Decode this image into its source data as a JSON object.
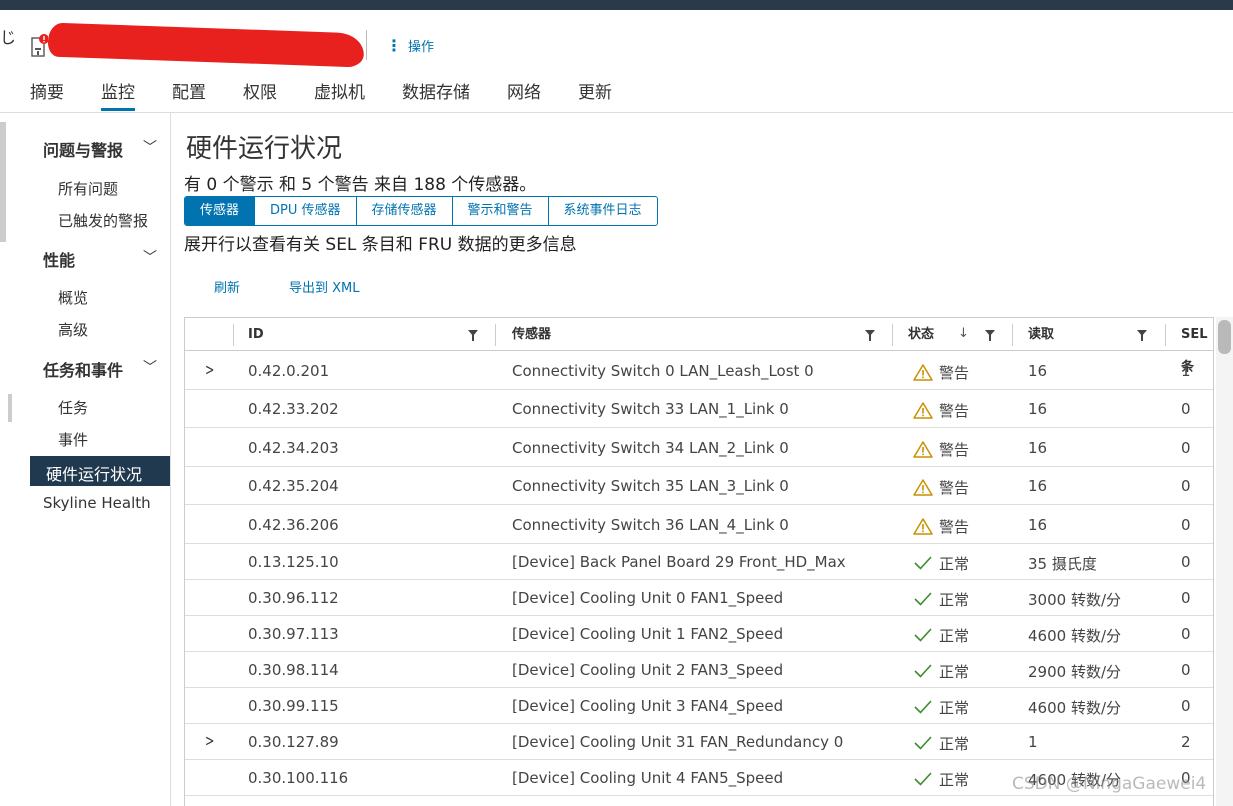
{
  "header": {
    "edge_char": "じ",
    "actions_label": "操作"
  },
  "tabs": [
    "摘要",
    "监控",
    "配置",
    "权限",
    "虚拟机",
    "数据存储",
    "网络",
    "更新"
  ],
  "active_tab": "监控",
  "sidebar": {
    "groups": [
      {
        "label": "问题与警报",
        "items": [
          "所有问题",
          "已触发的警报"
        ]
      },
      {
        "label": "性能",
        "items": [
          "概览",
          "高级"
        ]
      },
      {
        "label": "任务和事件",
        "items": [
          "任务",
          "事件"
        ]
      }
    ],
    "active_item": "硬件运行状况",
    "skyline": "Skyline Health"
  },
  "main": {
    "title": "硬件运行状况",
    "summary": "有 0 个警示 和 5 个警告 来自 188 个传感器。",
    "segments": [
      "传感器",
      "DPU 传感器",
      "存储传感器",
      "警示和警告",
      "系统事件日志"
    ],
    "active_segment": "传感器",
    "hint": "展开行以查看有关 SEL 条目和 FRU 数据的更多信息",
    "refresh": "刷新",
    "export": "导出到 XML"
  },
  "table": {
    "columns": {
      "id": "ID",
      "sensor": "传感器",
      "status": "状态",
      "reading": "读取",
      "sel": "SEL 条"
    },
    "rows": [
      {
        "expand": true,
        "id": "0.42.0.201",
        "sensor": "Connectivity Switch 0 LAN_Leash_Lost 0",
        "status": "警告",
        "level": "warning",
        "reading": "16",
        "sel": "1"
      },
      {
        "expand": false,
        "id": "0.42.33.202",
        "sensor": "Connectivity Switch 33 LAN_1_Link 0",
        "status": "警告",
        "level": "warning",
        "reading": "16",
        "sel": "0"
      },
      {
        "expand": false,
        "id": "0.42.34.203",
        "sensor": "Connectivity Switch 34 LAN_2_Link 0",
        "status": "警告",
        "level": "warning",
        "reading": "16",
        "sel": "0"
      },
      {
        "expand": false,
        "id": "0.42.35.204",
        "sensor": "Connectivity Switch 35 LAN_3_Link 0",
        "status": "警告",
        "level": "warning",
        "reading": "16",
        "sel": "0"
      },
      {
        "expand": false,
        "id": "0.42.36.206",
        "sensor": "Connectivity Switch 36 LAN_4_Link 0",
        "status": "警告",
        "level": "warning",
        "reading": "16",
        "sel": "0"
      },
      {
        "expand": false,
        "id": "0.13.125.10",
        "sensor": "[Device] Back Panel Board 29 Front_HD_Max",
        "status": "正常",
        "level": "normal",
        "reading": "35 摄氏度",
        "sel": "0"
      },
      {
        "expand": false,
        "id": "0.30.96.112",
        "sensor": "[Device] Cooling Unit 0 FAN1_Speed",
        "status": "正常",
        "level": "normal",
        "reading": "3000 转数/分",
        "sel": "0"
      },
      {
        "expand": false,
        "id": "0.30.97.113",
        "sensor": "[Device] Cooling Unit 1 FAN2_Speed",
        "status": "正常",
        "level": "normal",
        "reading": "4600 转数/分",
        "sel": "0"
      },
      {
        "expand": false,
        "id": "0.30.98.114",
        "sensor": "[Device] Cooling Unit 2 FAN3_Speed",
        "status": "正常",
        "level": "normal",
        "reading": "2900 转数/分",
        "sel": "0"
      },
      {
        "expand": false,
        "id": "0.30.99.115",
        "sensor": "[Device] Cooling Unit 3 FAN4_Speed",
        "status": "正常",
        "level": "normal",
        "reading": "4600 转数/分",
        "sel": "0"
      },
      {
        "expand": true,
        "id": "0.30.127.89",
        "sensor": "[Device] Cooling Unit 31 FAN_Redundancy 0",
        "status": "正常",
        "level": "normal",
        "reading": "1",
        "sel": "2"
      },
      {
        "expand": false,
        "id": "0.30.100.116",
        "sensor": "[Device] Cooling Unit 4 FAN5_Speed",
        "status": "正常",
        "level": "normal",
        "reading": "4600 转数/分",
        "sel": "0"
      }
    ]
  },
  "watermark": "CSDN @NingaGaewei4",
  "colors": {
    "accent": "#0073b0",
    "nav_active": "#21394f",
    "warning": "#d9a400",
    "ok": "#3c8c2d",
    "alert_badge": "#e8201e"
  }
}
